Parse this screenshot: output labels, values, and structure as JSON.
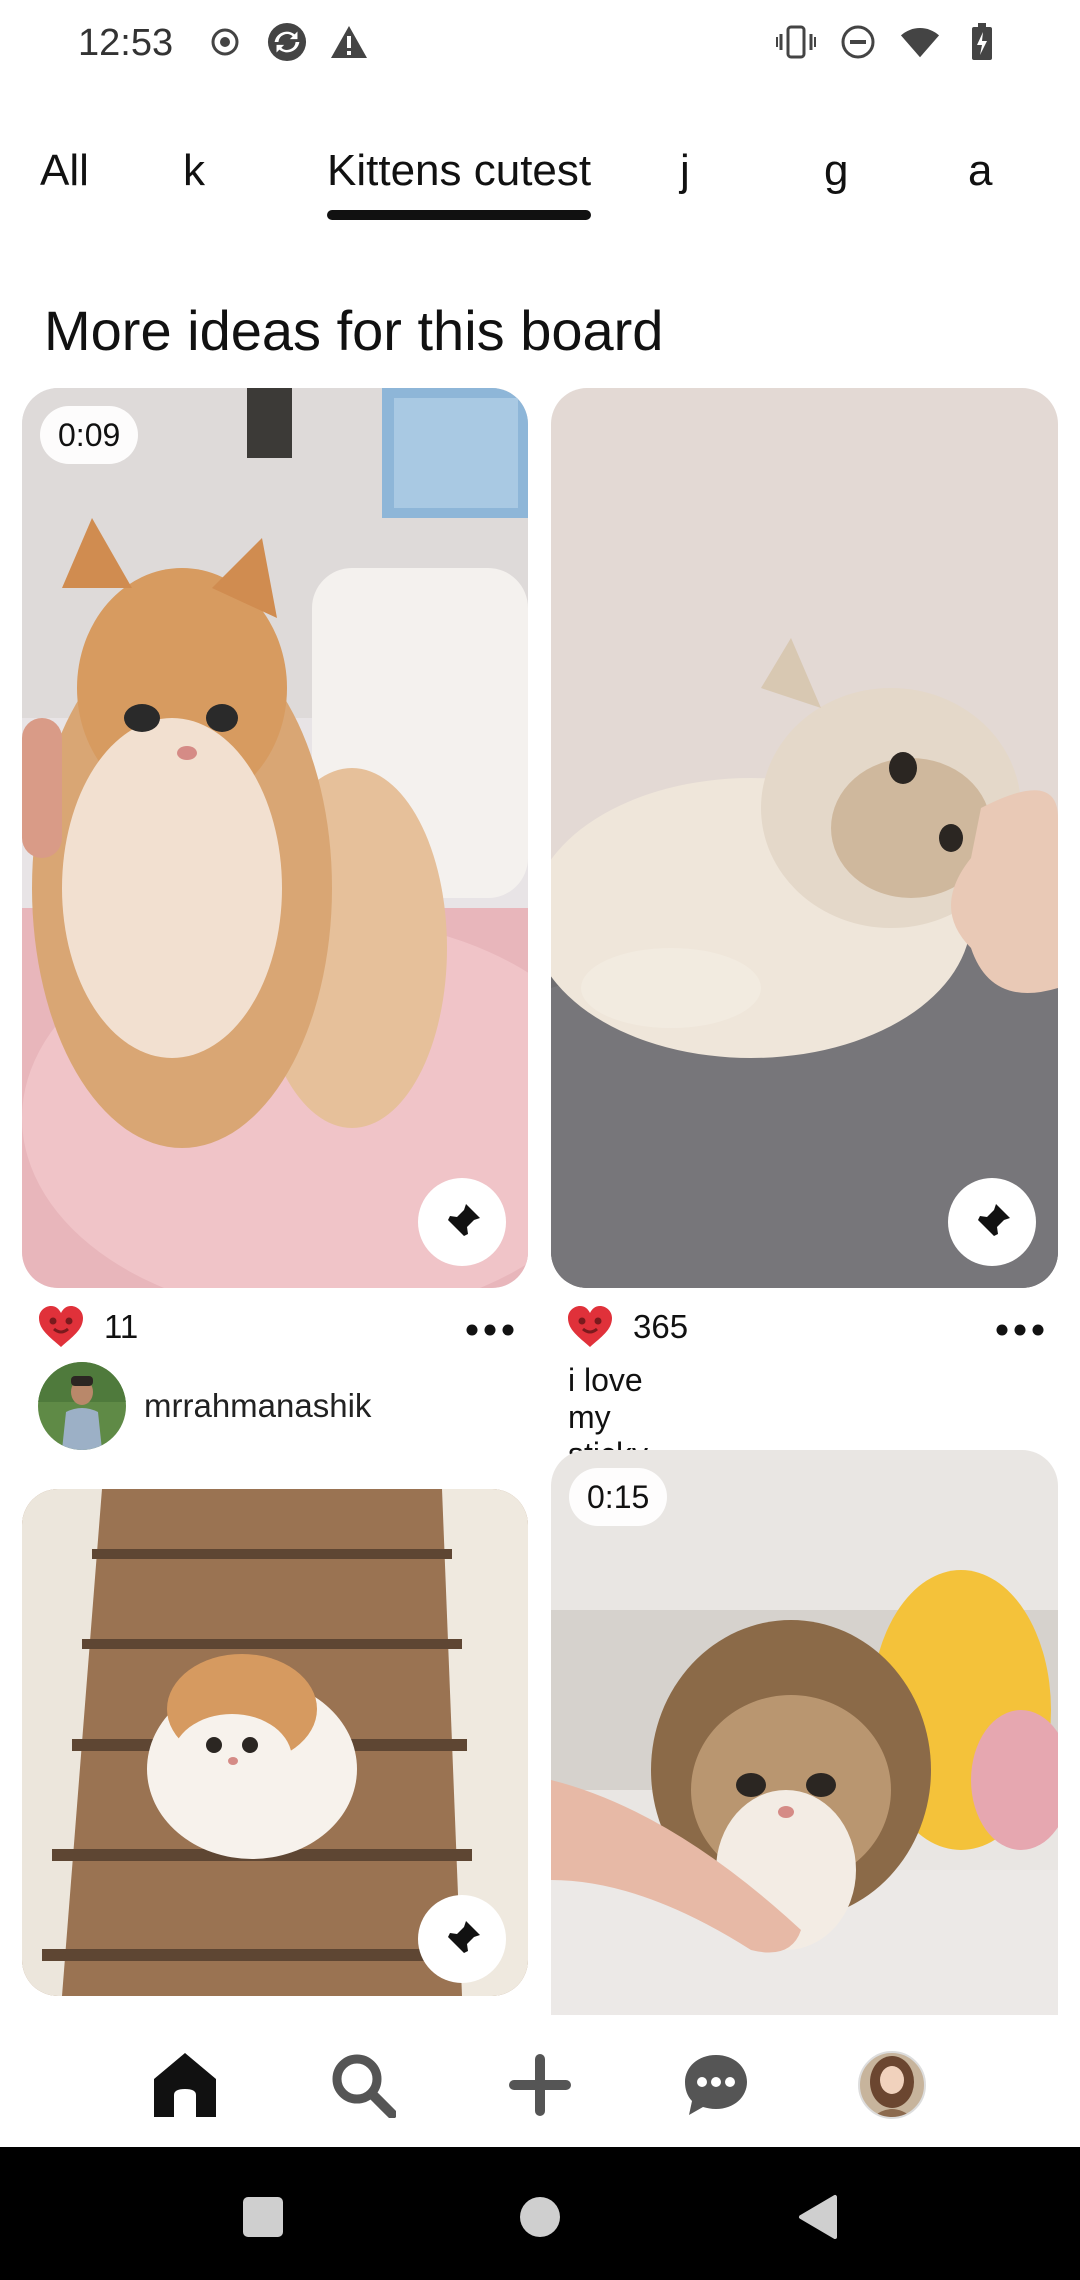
{
  "status_bar": {
    "time": "12:53",
    "left_icons": [
      "record-icon",
      "sync-icon",
      "warning-icon"
    ],
    "right_icons": [
      "vibrate-icon",
      "do-not-disturb-icon",
      "wifi-icon",
      "battery-charging-icon"
    ]
  },
  "tabs": [
    {
      "label": "All",
      "active": false
    },
    {
      "label": "k",
      "active": false
    },
    {
      "label": "Kittens cutest",
      "active": true
    },
    {
      "label": "j",
      "active": false
    },
    {
      "label": "g",
      "active": false
    },
    {
      "label": "a",
      "active": false
    }
  ],
  "section_title": "More ideas for this board",
  "pins": [
    {
      "duration": "0:09",
      "reactions": "11",
      "creator": "mrrahmanashik",
      "description": ""
    },
    {
      "duration": "",
      "reactions": "365",
      "creator": "",
      "description": "i love my sticky cat"
    },
    {
      "duration": "",
      "reactions": "",
      "creator": "",
      "description": ""
    },
    {
      "duration": "0:15",
      "reactions": "",
      "creator": "",
      "description": ""
    }
  ],
  "bottom_nav": [
    "home-icon",
    "search-icon",
    "create-icon",
    "messages-icon",
    "profile-avatar"
  ],
  "colors": {
    "heart": "#e0313a",
    "text": "#111111",
    "nav_bg": "#000000"
  }
}
